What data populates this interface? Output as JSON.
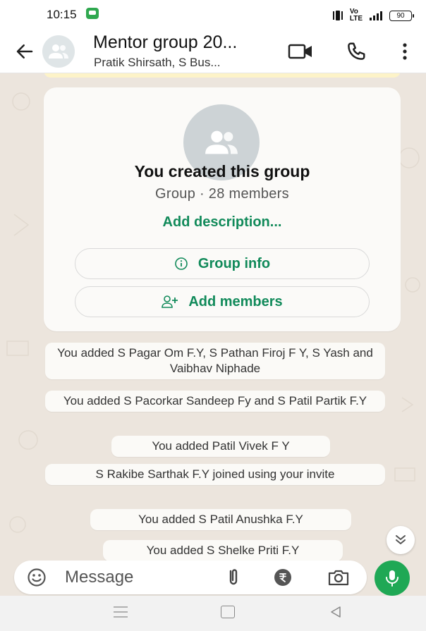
{
  "status_bar": {
    "time": "10:15",
    "battery": "90",
    "network": "Vo LTE"
  },
  "header": {
    "title": "Mentor group 20...",
    "subtitle": "Pratik Shirsath, S Bus..."
  },
  "group_card": {
    "title": "You created this group",
    "subtitle": "Group · 28 members",
    "add_description": "Add description...",
    "group_info_label": "Group info",
    "add_members_label": "Add members"
  },
  "system_messages": [
    {
      "text": "You added S Pagar Om F.Y, S Pathan Firoj F Y, S Yash and Vaibhav Niphade"
    },
    {
      "text": "You added S Pacorkar Sandeep Fy and S Patil Partik F.Y"
    },
    {
      "text": "You added Patil Vivek F Y"
    },
    {
      "text": "S Rakibe Sarthak F.Y joined using your invite"
    },
    {
      "text": "You added S Patil Anushka F.Y"
    },
    {
      "text": "You added S Shelke Priti F.Y"
    }
  ],
  "composer": {
    "placeholder": "Message"
  },
  "colors": {
    "accent": "#118a5a",
    "mic": "#1fa855",
    "chat_bg": "#ece5dd"
  },
  "icons": [
    "back-arrow-icon",
    "group-avatar-icon",
    "video-call-icon",
    "phone-icon",
    "more-vert-icon",
    "info-icon",
    "add-person-icon",
    "scroll-down-icon",
    "emoji-icon",
    "attach-icon",
    "rupee-icon",
    "camera-icon",
    "mic-icon"
  ]
}
